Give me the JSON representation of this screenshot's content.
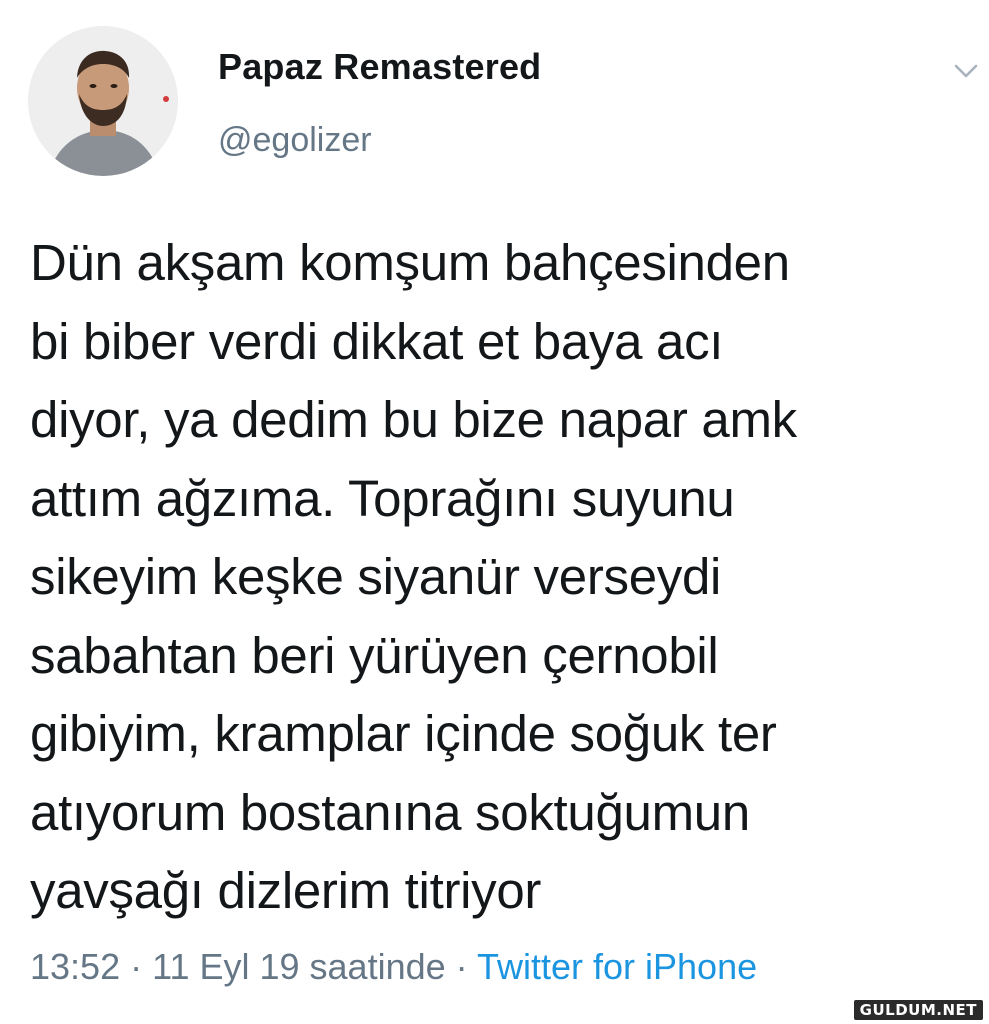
{
  "user": {
    "display_name": "Papaz Remastered",
    "handle": "@egolizer",
    "avatar_icon": "profile-photo"
  },
  "menu": {
    "icon": "chevron-down-icon"
  },
  "tweet": {
    "lines": [
      "Dün akşam komşum bahçesinden",
      "bi biber verdi dikkat et baya acı",
      "diyor, ya dedim bu bize napar amk",
      "attım ağzıma. Toprağını suyunu",
      "sikeyim keşke siyanür verseydi",
      "sabahtan beri yürüyen çernobil",
      "gibiyim, kramplar içinde soğuk ter",
      "atıyorum bostanına soktuğumun",
      "yavşağı dizlerim titriyor"
    ]
  },
  "meta": {
    "time": "13:52",
    "separator": " · ",
    "date": "11 Eyl 19 saatinde",
    "source": "Twitter for iPhone"
  },
  "watermark": "GULDUM.NET",
  "colors": {
    "text": "#14171a",
    "secondary": "#657786",
    "link": "#1b95e0"
  }
}
